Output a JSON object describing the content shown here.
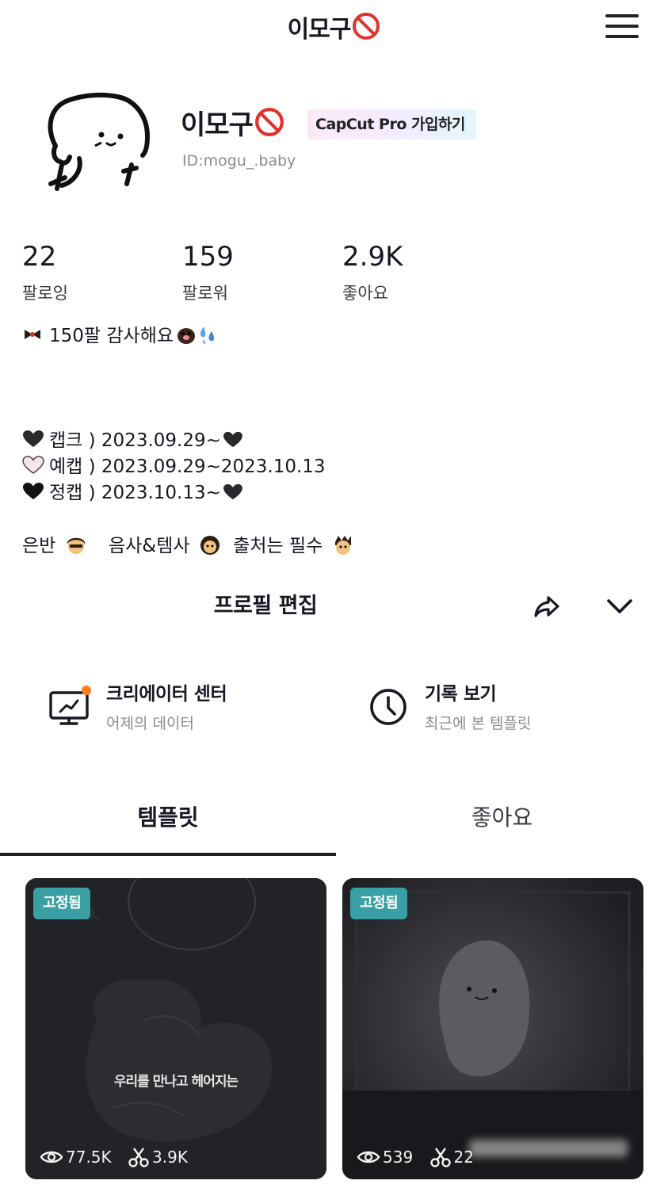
{
  "header": {
    "title": "이모구"
  },
  "profile": {
    "name": "이모구",
    "pro_button": "CapCut Pro 가입하기",
    "user_id": "ID:mogu_.baby"
  },
  "stats": [
    {
      "value": "22",
      "label": "팔로잉"
    },
    {
      "value": "159",
      "label": "팔로워"
    },
    {
      "value": "2.9K",
      "label": "좋아요"
    }
  ],
  "bio": {
    "line1": "150팔 감사해요",
    "history": [
      {
        "text": "캡크 ) 2023.09.29~",
        "heart_color": "#2a2a2e"
      },
      {
        "text": "예캡 ) 2023.09.29~2023.10.13",
        "heart_color": "#f3e6e8"
      },
      {
        "text": "정캡 ) 2023.10.13~",
        "heart_color": "#111111"
      }
    ],
    "rules": [
      "은반",
      "음사&템사",
      "출처는 필수"
    ]
  },
  "actions": {
    "edit_profile": "프로필 편집"
  },
  "quick_links": [
    {
      "title": "크리에이터 센터",
      "subtitle": "어제의 데이터",
      "icon": "monitor-chart-icon",
      "has_badge": true
    },
    {
      "title": "기록 보기",
      "subtitle": "최근에 본 템플릿",
      "icon": "clock-icon",
      "has_badge": false
    }
  ],
  "tabs": [
    {
      "label": "템플릿",
      "active": true
    },
    {
      "label": "좋아요",
      "active": false
    }
  ],
  "templates": [
    {
      "pin_label": "고정됨",
      "caption": "우리를 만나고 헤어지는",
      "views": "77.5K",
      "uses": "3.9K"
    },
    {
      "pin_label": "고정됨",
      "caption": "",
      "views": "539",
      "uses": "22"
    }
  ],
  "colors": {
    "accent_badge": "#ff7a1a",
    "pin_badge": "#3aa0a4",
    "text_primary": "#161823",
    "text_secondary": "#8a8b91"
  }
}
